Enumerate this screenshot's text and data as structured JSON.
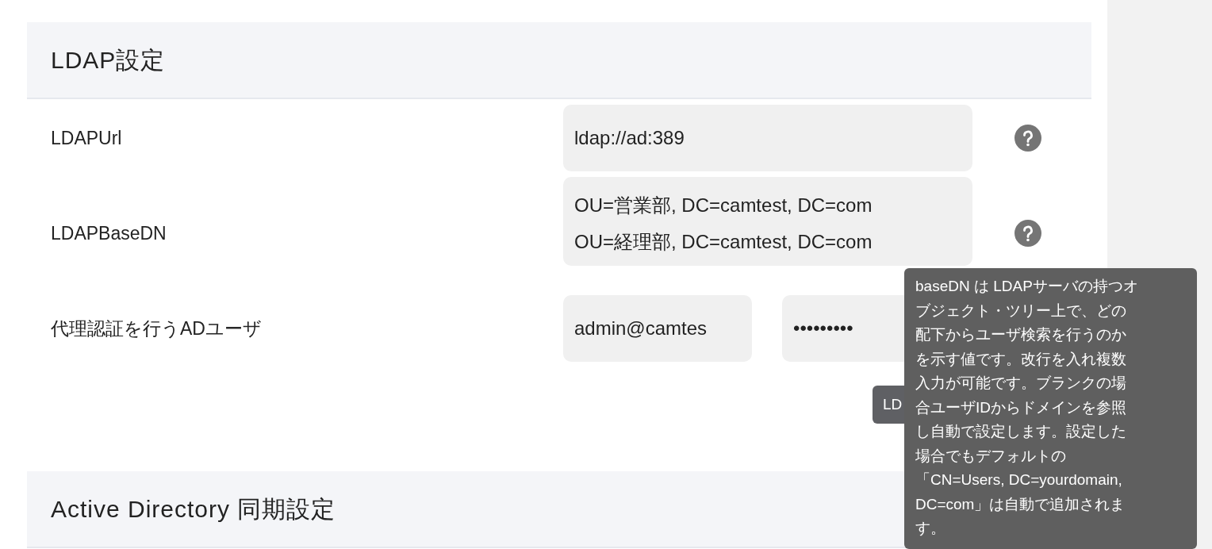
{
  "sections": [
    {
      "title": "LDAP設定"
    },
    {
      "title": "Active Directory 同期設定"
    }
  ],
  "fields": [
    {
      "kind": "text",
      "label": "LDAPUrl",
      "values": [
        "ldap://ad:389"
      ],
      "help": true
    },
    {
      "kind": "textarea",
      "label": "LDAPBaseDN",
      "values": [
        "OU=営業部, DC=camtest, DC=com",
        "OU=経理部, DC=camtest, DC=com"
      ],
      "help": true
    },
    {
      "kind": "pair",
      "label": "代理認証を行うADユーザ",
      "values": [
        "admin@camtes",
        "•••••••••"
      ],
      "help": false
    }
  ],
  "back_tooltip": {
    "text": "LD"
  },
  "tooltip": {
    "lines": [
      "baseDN は LDAPサーバの持つオ",
      "ブジェクト・ツリー上で、どの",
      "配下からユーザ検索を行うのか",
      "を示す値です。改行を入れ複数",
      "入力が可能です。ブランクの場",
      "合ユーザIDからドメインを参照",
      "し自動で設定します。設定した",
      "場合でもデフォルトの",
      "「CN=Users, DC=yourdomain,",
      "DC=com」は自動で追加されま",
      "す。"
    ]
  }
}
